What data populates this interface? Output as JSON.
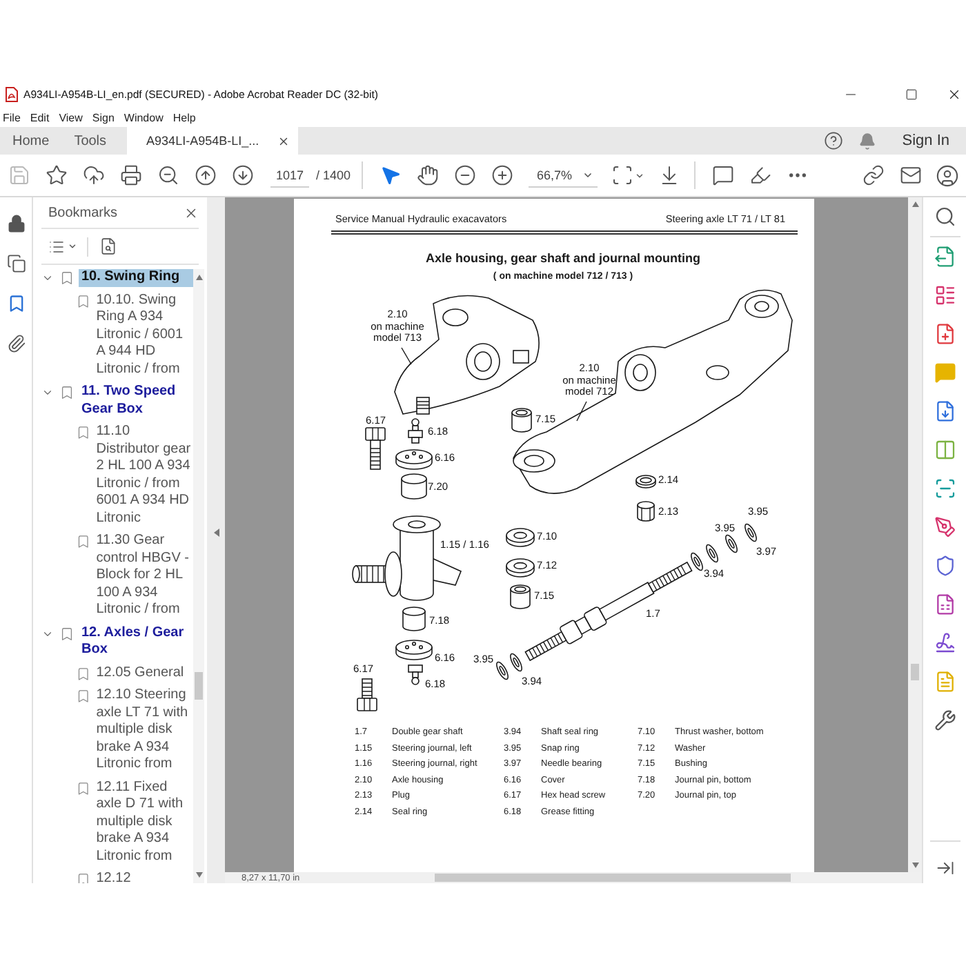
{
  "window": {
    "title": "A934LI-A954B-LI_en.pdf (SECURED) - Adobe Acrobat Reader DC (32-bit)"
  },
  "menu": [
    "File",
    "Edit",
    "View",
    "Sign",
    "Window",
    "Help"
  ],
  "tabs": [
    {
      "label": "Home",
      "selected": false,
      "closable": false
    },
    {
      "label": "Tools",
      "selected": false,
      "closable": false
    },
    {
      "label": "A934LI-A954B-LI_...",
      "selected": true,
      "closable": true
    }
  ],
  "sign_in": "Sign In",
  "toolbar": {
    "page": "1017",
    "page_count": "/ 1400",
    "zoom": "66,7%",
    "tools": [
      {
        "selected": true
      },
      {
        "selected": false
      }
    ]
  },
  "side_nav": [
    {
      "selected": false
    },
    {
      "selected": false
    },
    {
      "selected": true
    },
    {
      "selected": false
    }
  ],
  "bookmarks": {
    "title": "Bookmarks",
    "items": [
      {
        "label": "10. Swing Ring",
        "selected": true,
        "expanded": true,
        "children": [
          {
            "label": "10.10. Swing Ring A 934 Litronic / 6001 A 944 HD Litronic / from",
            "selected": false
          }
        ]
      },
      {
        "label": "11. Two Speed Gear Box",
        "selected": false,
        "expanded": true,
        "children": [
          {
            "label": "11.10 Distributor gear 2 HL 100 A 934 Litronic / from 6001 A 934 HD Litronic",
            "selected": false
          },
          {
            "label": "11.30 Gear control HBGV - Block for 2 HL 100 A 934 Litronic / from",
            "selected": false
          }
        ]
      },
      {
        "label": "12. Axles / Gear Box",
        "selected": false,
        "expanded": true,
        "children": [
          {
            "label": "12.05 General",
            "selected": false
          },
          {
            "label": "12.10 Steering axle LT 71 with multiple disk brake A 934 Litronic from",
            "selected": false
          },
          {
            "label": "12.11 Fixed axle D 71 with multiple disk brake A 934 Litronic from",
            "selected": false
          },
          {
            "label": "12.12",
            "selected": false
          }
        ]
      }
    ]
  },
  "document": {
    "header_left": "Service Manual Hydraulic exacavators",
    "header_right": "Steering axle LT 71 / LT 81",
    "title": "Axle housing, gear shaft and journal mounting",
    "subtitle": "( on machine model 712 / 713 )",
    "callouts": [
      {
        "lines": [
          "2.10",
          "on machine",
          "model 713"
        ]
      },
      {
        "lines": [
          "2.10",
          "on machine",
          "model 712"
        ]
      },
      {
        "lines": [
          "6.17"
        ]
      },
      {
        "lines": [
          "7.15"
        ]
      },
      {
        "lines": [
          "6.18"
        ]
      },
      {
        "lines": [
          "6.16"
        ]
      },
      {
        "lines": [
          "2.14"
        ]
      },
      {
        "lines": [
          "7.20"
        ]
      },
      {
        "lines": [
          "3.95"
        ]
      },
      {
        "lines": [
          "2.13"
        ]
      },
      {
        "lines": [
          "3.95"
        ]
      },
      {
        "lines": [
          "7.10"
        ]
      },
      {
        "lines": [
          "1.15 / 1.16"
        ]
      },
      {
        "lines": [
          "3.97"
        ]
      },
      {
        "lines": [
          "7.12"
        ]
      },
      {
        "lines": [
          "3.94"
        ]
      },
      {
        "lines": [
          "7.15"
        ]
      },
      {
        "lines": [
          "1.7"
        ]
      },
      {
        "lines": [
          "7.18"
        ]
      },
      {
        "lines": [
          "3.95"
        ]
      },
      {
        "lines": [
          "6.16"
        ]
      },
      {
        "lines": [
          "6.17"
        ]
      },
      {
        "lines": [
          "3.94"
        ]
      },
      {
        "lines": [
          "6.18"
        ]
      }
    ],
    "legend": [
      {
        "number": "1.7",
        "name": "Double gear shaft"
      },
      {
        "number": "1.15",
        "name": "Steering journal, left"
      },
      {
        "number": "1.16",
        "name": "Steering journal, right"
      },
      {
        "number": "2.10",
        "name": "Axle housing"
      },
      {
        "number": "2.13",
        "name": "Plug"
      },
      {
        "number": "2.14",
        "name": "Seal ring"
      },
      {
        "number": "3.94",
        "name": "Shaft seal ring"
      },
      {
        "number": "3.95",
        "name": "Snap ring"
      },
      {
        "number": "3.97",
        "name": "Needle bearing"
      },
      {
        "number": "6.16",
        "name": "Cover"
      },
      {
        "number": "6.17",
        "name": "Hex head screw"
      },
      {
        "number": "6.18",
        "name": "Grease fitting"
      },
      {
        "number": "7.10",
        "name": "Thrust washer, bottom"
      },
      {
        "number": "7.12",
        "name": "Washer"
      },
      {
        "number": "7.15",
        "name": "Bushing"
      },
      {
        "number": "7.18",
        "name": "Journal pin, bottom"
      },
      {
        "number": "7.20",
        "name": "Journal pin, top"
      }
    ]
  },
  "status": {
    "page_size": "8,27 x 11,70 in"
  }
}
